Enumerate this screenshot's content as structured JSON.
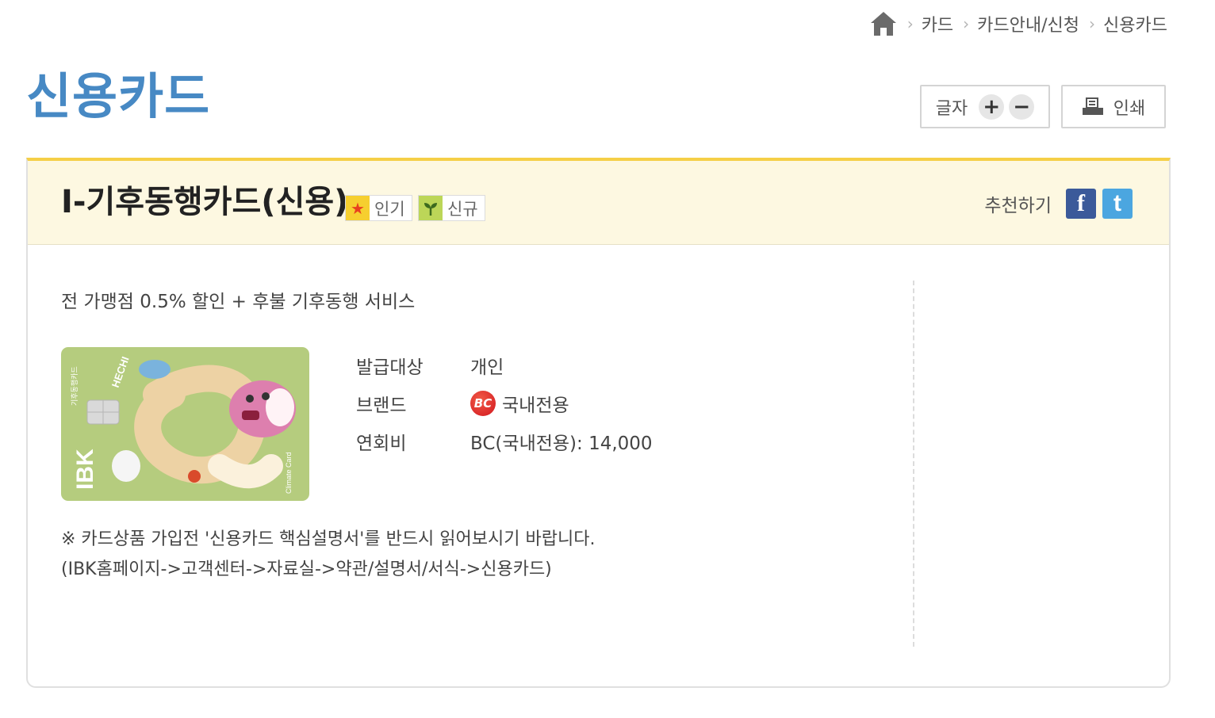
{
  "breadcrumb": {
    "home_icon": "home-icon",
    "items": [
      "카드",
      "카드안내/신청",
      "신용카드"
    ]
  },
  "page": {
    "title": "신용카드",
    "title_color": "#4789c4"
  },
  "tools": {
    "font_label": "글자",
    "plus": "+",
    "minus": "−",
    "print_label": "인쇄"
  },
  "product": {
    "name": "I-기후동행카드(신용)",
    "badges": [
      {
        "label": "인기",
        "icon": "star-icon"
      },
      {
        "label": "신규",
        "icon": "sprout-icon"
      }
    ],
    "recommend_label": "추천하기",
    "sns": {
      "facebook": "f",
      "twitter": "t"
    },
    "summary": "전 가맹점 0.5% 할인 + 후불 기후동행 서비스",
    "info": [
      {
        "label": "발급대상",
        "value": "개인"
      },
      {
        "label": "브랜드",
        "value": "국내전용",
        "logo": "BC"
      },
      {
        "label": "연회비",
        "value": "BC(국내전용): 14,000"
      }
    ],
    "notice": [
      "※ 카드상품 가입전 '신용카드 핵심설명서'를 반드시 읽어보시기 바랍니다.",
      "(IBK홈페이지->고객센터->자료실->약관/설명서/서식->신용카드)"
    ],
    "card_image": {
      "bank": "IBK",
      "card_name": "기후동행카드",
      "character": "HECHI",
      "caption": "Climate Card",
      "accent_color": "#b5cc7e"
    }
  }
}
